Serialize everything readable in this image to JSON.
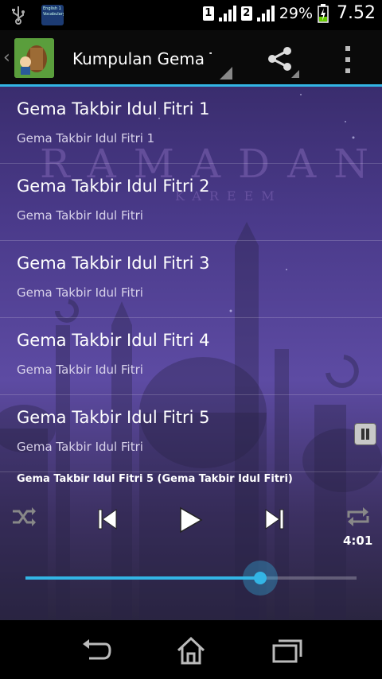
{
  "status_bar": {
    "notification_app_text": "English 1 Vocabulary",
    "sim1": "1",
    "sim2": "2",
    "battery": "29%",
    "time": "7.52"
  },
  "action_bar": {
    "title": "Kumpulan Gema Takbir Idul Fitri"
  },
  "background": {
    "text": "RAMADAN",
    "subtext": "KAREEM"
  },
  "list": [
    {
      "title": "Gema Takbir Idul Fitri 1",
      "subtitle": "Gema Takbir Idul Fitri 1"
    },
    {
      "title": "Gema Takbir Idul Fitri 2",
      "subtitle": "Gema Takbir Idul Fitri"
    },
    {
      "title": "Gema Takbir Idul Fitri 3",
      "subtitle": "Gema Takbir Idul Fitri"
    },
    {
      "title": "Gema Takbir Idul Fitri 4",
      "subtitle": "Gema Takbir Idul Fitri"
    },
    {
      "title": "Gema Takbir Idul Fitri 5",
      "subtitle": "Gema Takbir Idul Fitri"
    }
  ],
  "player": {
    "now_playing": "Gema Takbir Idul Fitri 5 (Gema Takbir Idul Fitri)",
    "duration": "4:01",
    "progress": 0.71
  },
  "colors": {
    "accent": "#33b5e5"
  }
}
